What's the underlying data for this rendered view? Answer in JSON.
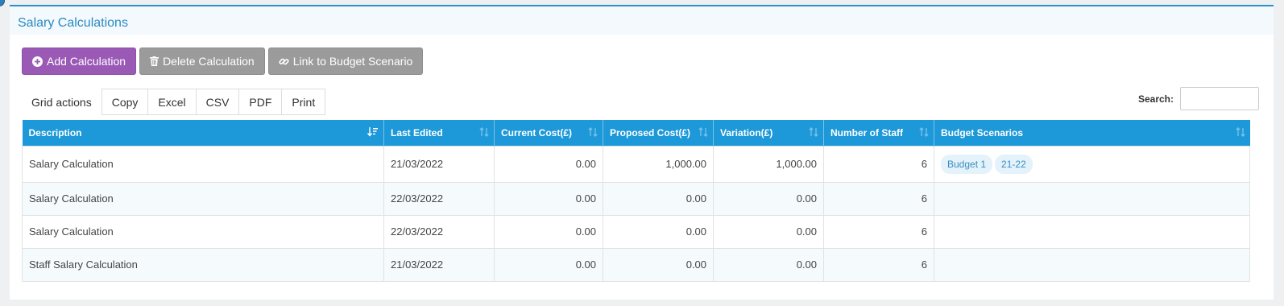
{
  "panel": {
    "title": "Salary Calculations"
  },
  "toolbar": {
    "add_label": "Add Calculation",
    "delete_label": "Delete Calculation",
    "link_label": "Link to Budget Scenario"
  },
  "grid_actions": {
    "label": "Grid actions",
    "buttons": [
      "Copy",
      "Excel",
      "CSV",
      "PDF",
      "Print"
    ]
  },
  "search": {
    "label": "Search:",
    "value": ""
  },
  "table": {
    "columns": [
      "Description",
      "Last Edited",
      "Current Cost(£)",
      "Proposed Cost(£)",
      "Variation(£)",
      "Number of Staff",
      "Budget Scenarios"
    ],
    "rows": [
      {
        "description": "Salary Calculation",
        "last_edited": "21/03/2022",
        "current_cost": "0.00",
        "proposed_cost": "1,000.00",
        "variation": "1,000.00",
        "staff": "6",
        "scenarios": [
          "Budget 1",
          "21-22"
        ]
      },
      {
        "description": "Salary Calculation",
        "last_edited": "22/03/2022",
        "current_cost": "0.00",
        "proposed_cost": "0.00",
        "variation": "0.00",
        "staff": "6",
        "scenarios": []
      },
      {
        "description": "Salary Calculation",
        "last_edited": "22/03/2022",
        "current_cost": "0.00",
        "proposed_cost": "0.00",
        "variation": "0.00",
        "staff": "6",
        "scenarios": []
      },
      {
        "description": "Staff Salary Calculation",
        "last_edited": "21/03/2022",
        "current_cost": "0.00",
        "proposed_cost": "0.00",
        "variation": "0.00",
        "staff": "6",
        "scenarios": []
      }
    ]
  },
  "colors": {
    "header_bg": "#1d98d8",
    "accent_title": "#2a8bc0",
    "add_button": "#9b59b6",
    "gray_button": "#9b9b9b"
  },
  "icons": {
    "add": "plus-circle-icon",
    "delete": "trash-icon",
    "link": "link-icon",
    "sort_active": "sort-alpha-asc-icon",
    "sort_inactive": "sort-icon"
  }
}
